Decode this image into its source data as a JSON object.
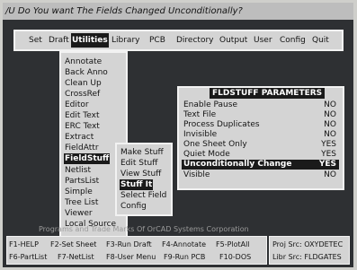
{
  "window": {
    "prompt": "/U Do You want The Fields Changed Unconditionally?"
  },
  "menubar": {
    "items": [
      "Set",
      "Draft",
      "Utilities",
      "Library",
      "PCB",
      "Directory",
      "Output",
      "User",
      "Config",
      "Quit"
    ],
    "selected": "Utilities"
  },
  "utilities_menu": {
    "items": [
      "Annotate",
      "Back Anno",
      "Clean Up",
      "CrossRef",
      "Editor",
      "Edit Text",
      "ERC Text",
      "Extract",
      "FieldAttr",
      "FieldStuff",
      "Netlist",
      "PartsList",
      "Simple",
      "Tree List",
      "Viewer",
      "Local Source"
    ],
    "selected": "FieldStuff"
  },
  "fieldstuff_menu": {
    "items": [
      "Make Stuff",
      "Edit Stuff",
      "View Stuff",
      "Stuff It",
      "Select Field",
      "Config"
    ],
    "selected": "Stuff It"
  },
  "parameters": {
    "title": "FLDSTUFF PARAMETERS",
    "rows": [
      {
        "label": "Enable Pause",
        "value": "NO"
      },
      {
        "label": "Text File",
        "value": "NO"
      },
      {
        "label": "Process Duplicates",
        "value": "NO"
      },
      {
        "label": "Invisible",
        "value": "NO"
      },
      {
        "label": "One Sheet Only",
        "value": "YES"
      },
      {
        "label": "Quiet Mode",
        "value": "YES"
      },
      {
        "label": "Unconditionally Change",
        "value": "YES"
      },
      {
        "label": "Visible",
        "value": "NO"
      }
    ],
    "selected": "Unconditionally Change"
  },
  "copyright": "Programs and Trade Marks Of OrCAD Systems Corporation",
  "function_keys": {
    "row1": [
      "F1-HELP",
      "F2-Set Sheet",
      "F3-Run Draft",
      "F4-Annotate",
      "F5-PlotAll"
    ],
    "row2": [
      "F6-PartList",
      "F7-NetList",
      "F8-User Menu",
      "F9-Run PCB",
      "F10-DOS"
    ]
  },
  "project": {
    "proj_src": "Proj Src: OXYDETEC",
    "libr_src": "Libr Src: FLDGATES"
  },
  "colors": {
    "screen_bg": "#2e3033",
    "panel_bg": "#d4d4d4",
    "highlight_bg": "#1a1a1a",
    "highlight_fg": "#ffffff"
  }
}
